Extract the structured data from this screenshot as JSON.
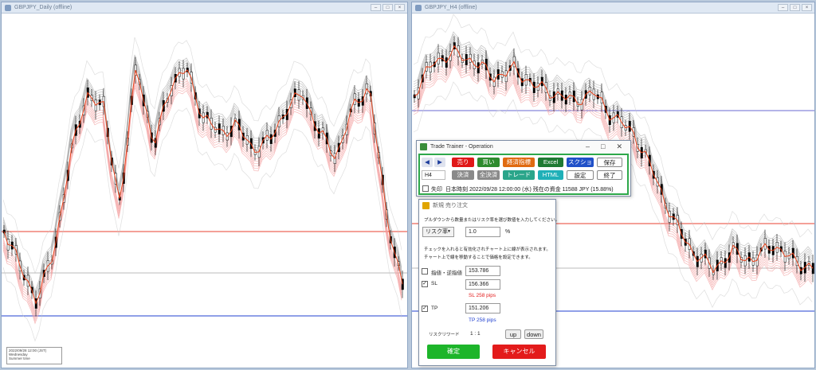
{
  "left_window": {
    "title": "GBPJPY_Daily (offline)",
    "info": [
      "2022/09/28 12:00 (JST)",
      "Wednesday",
      "Summer time",
      "D1"
    ]
  },
  "right_window": {
    "title": "GBPJPY_H4 (offline)"
  },
  "colors": {
    "sell_red": "#e01818",
    "buy_green": "#2e8b2e",
    "settle_orange": "#e06a10",
    "excel_green": "#1f7a33",
    "screenshot_blue": "#2050c8",
    "gray_btn": "#8a8a8a",
    "trade_teal": "#2aa58a",
    "html_teal": "#20b0b8",
    "confirm_green": "#1db52a",
    "cancel_red": "#e31b1b",
    "sl_text": "#e31b1b",
    "tp_text": "#2040d0"
  },
  "trainer": {
    "title": "Trade Trainer - Operation",
    "buttons": {
      "sell": "売り",
      "buy": "買い",
      "settle_pending": "経済指標",
      "excel": "Excel",
      "screenshot": "スクショ",
      "save": "保存",
      "settle": "決済",
      "settle_all": "全決済",
      "trade": "トレード",
      "html": "HTML",
      "settings": "設定",
      "exit": "終了"
    },
    "timeframe": "H4",
    "prev_icon": "◀",
    "next_icon": "▶",
    "checkbox_label": "失印",
    "status": "日本時刻 2022/09/28 12:00:00 (水)  残在の資金 11588 JPY (15.88%)"
  },
  "order": {
    "title": "新規 売り注文",
    "description": "プルダウンから数量またはリスク率を選び数値を入力してください。",
    "mode": "リスク率",
    "mode_value": "1.0",
    "unit": "%",
    "note1": "チェックを入れると有効化されチャート上に線が表示されます。",
    "note2": "チャート上で線を移動することで価格を設定できます。",
    "limit_label": "指値・逆指値",
    "limit_value": "153.786",
    "sl_label": "SL",
    "sl_value": "156.366",
    "sl_pips": "SL 258 pips",
    "tp_label": "TP",
    "tp_value": "151.206",
    "tp_pips": "TP 258 pips",
    "rr_label": "リスクリワード",
    "rr_value": "1 : 1",
    "up": "up",
    "down": "down",
    "confirm": "確定",
    "cancel": "キャンセル"
  }
}
